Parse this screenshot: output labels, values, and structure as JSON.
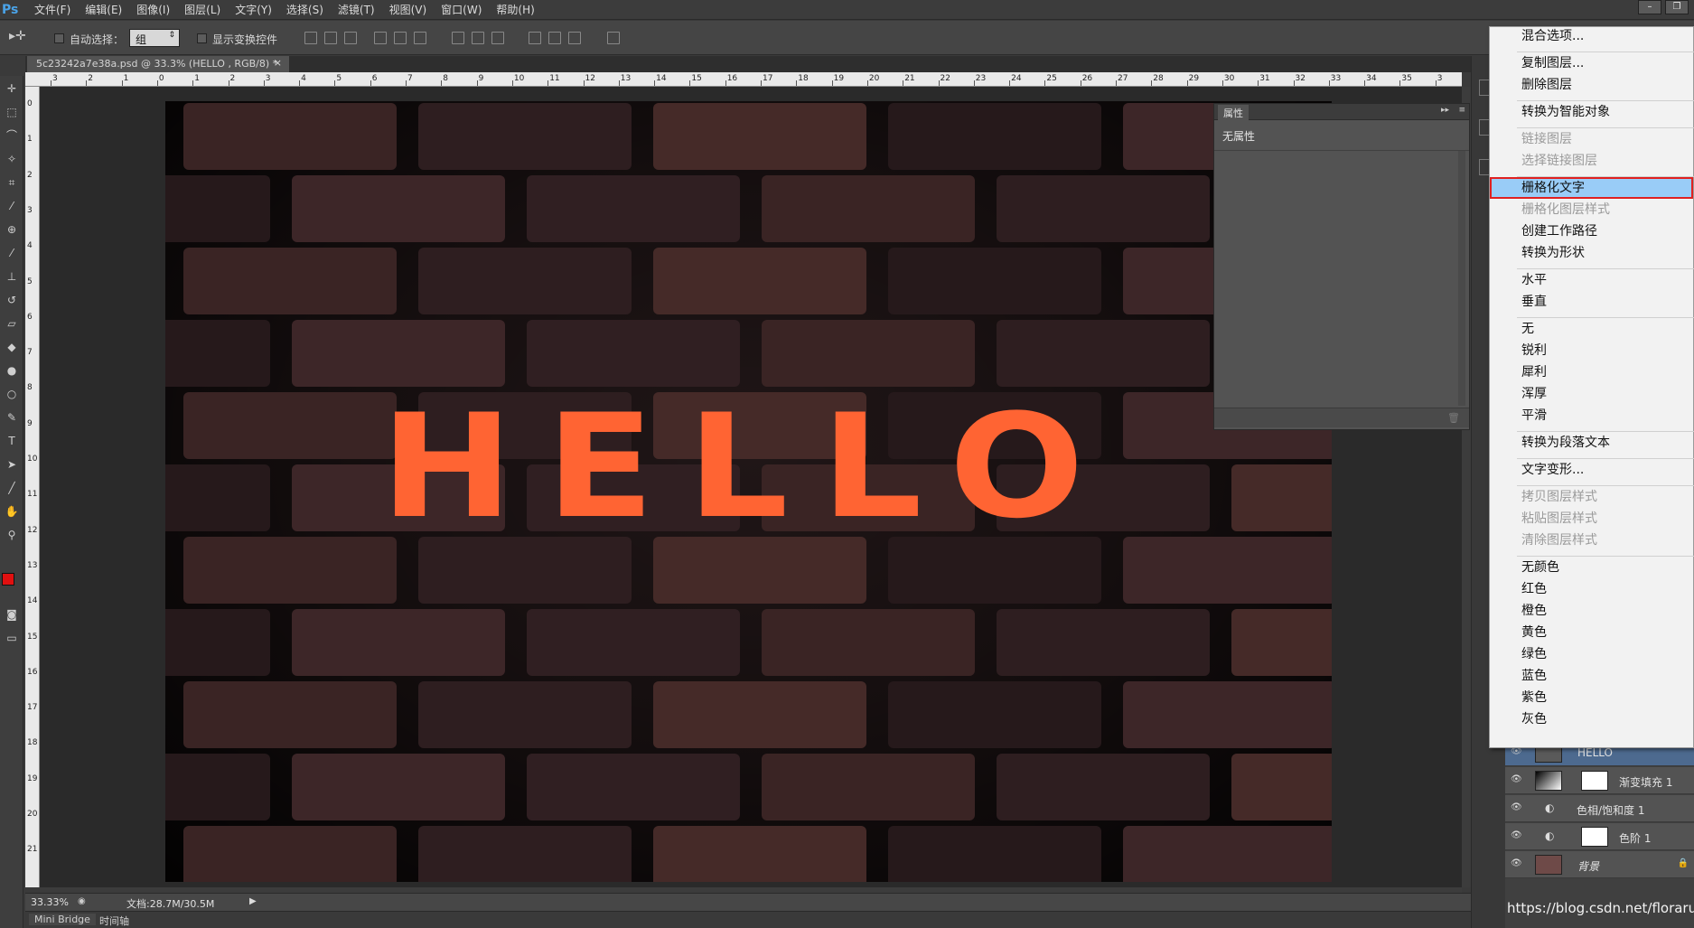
{
  "app": {
    "logo": "Ps"
  },
  "menubar": {
    "items": [
      "文件(F)",
      "编辑(E)",
      "图像(I)",
      "图层(L)",
      "文字(Y)",
      "选择(S)",
      "滤镜(T)",
      "视图(V)",
      "窗口(W)",
      "帮助(H)"
    ],
    "win_min": "–",
    "win_restore": "❐"
  },
  "options": {
    "auto_select_label": "自动选择：",
    "group_value": "组",
    "show_transform_label": "显示变换控件"
  },
  "document": {
    "tab_title": "5c23242a7e38a.psd @ 33.3% (HELLO , RGB/8) *",
    "close": "×",
    "canvas_text": "HELLO",
    "ruler_h": [
      "3",
      "2",
      "1",
      "0",
      "1",
      "2",
      "3",
      "4",
      "5",
      "6",
      "7",
      "8",
      "9",
      "10",
      "11",
      "12",
      "13",
      "14",
      "15",
      "16",
      "17",
      "18",
      "19",
      "20",
      "21",
      "22",
      "23",
      "24",
      "25",
      "26",
      "27",
      "28",
      "29",
      "30",
      "31",
      "32",
      "33",
      "34",
      "35",
      "3"
    ],
    "ruler_v": [
      "0",
      "1",
      "2",
      "3",
      "4",
      "5",
      "6",
      "7",
      "8",
      "9",
      "10",
      "11",
      "12",
      "13",
      "14",
      "15",
      "16",
      "17",
      "18",
      "19",
      "20",
      "21"
    ]
  },
  "properties": {
    "tab": "属性",
    "body": "无属性"
  },
  "context_menu": {
    "items": [
      {
        "label": "混合选项...",
        "disabled": false
      },
      {
        "sep": true
      },
      {
        "label": "复制图层...",
        "disabled": false
      },
      {
        "label": "删除图层",
        "disabled": false
      },
      {
        "sep": true
      },
      {
        "label": "转换为智能对象",
        "disabled": false
      },
      {
        "sep": true
      },
      {
        "label": "链接图层",
        "disabled": true
      },
      {
        "label": "选择链接图层",
        "disabled": true
      },
      {
        "sep": true
      },
      {
        "label": "栅格化文字",
        "disabled": false,
        "highlighted": true
      },
      {
        "label": "栅格化图层样式",
        "disabled": true
      },
      {
        "label": "创建工作路径",
        "disabled": false
      },
      {
        "label": "转换为形状",
        "disabled": false
      },
      {
        "sep": true
      },
      {
        "label": "水平",
        "disabled": false
      },
      {
        "label": "垂直",
        "disabled": false
      },
      {
        "sep": true
      },
      {
        "label": "无",
        "disabled": false
      },
      {
        "label": "锐利",
        "disabled": false
      },
      {
        "label": "犀利",
        "disabled": false
      },
      {
        "label": "浑厚",
        "disabled": false
      },
      {
        "label": "平滑",
        "disabled": false
      },
      {
        "sep": true
      },
      {
        "label": "转换为段落文本",
        "disabled": false
      },
      {
        "sep": true
      },
      {
        "label": "文字变形...",
        "disabled": false
      },
      {
        "sep": true
      },
      {
        "label": "拷贝图层样式",
        "disabled": true
      },
      {
        "label": "粘贴图层样式",
        "disabled": true
      },
      {
        "label": "清除图层样式",
        "disabled": true
      },
      {
        "sep": true
      },
      {
        "label": "无颜色",
        "disabled": false
      },
      {
        "label": "红色",
        "disabled": false
      },
      {
        "label": "橙色",
        "disabled": false
      },
      {
        "label": "黄色",
        "disabled": false
      },
      {
        "label": "绿色",
        "disabled": false
      },
      {
        "label": "蓝色",
        "disabled": false
      },
      {
        "label": "紫色",
        "disabled": false
      },
      {
        "label": "灰色",
        "disabled": false
      }
    ]
  },
  "layers": [
    {
      "name": "HELLO",
      "type": "text"
    },
    {
      "name": "渐变填充 1",
      "type": "gradient"
    },
    {
      "name": "色相/饱和度 1",
      "type": "adjust"
    },
    {
      "name": "色阶 1",
      "type": "adjust-mask"
    },
    {
      "name": "背景",
      "type": "image"
    }
  ],
  "status": {
    "zoom": "33.33%",
    "doc_size": "文档:28.7M/30.5M"
  },
  "bottom_tabs": [
    "Mini Bridge",
    "时间轴"
  ],
  "watermark": "https://blog.csdn.net/floraruo",
  "colors": {
    "foreground": "#e01010",
    "background": "#f0c8b0",
    "text": "#ff6433",
    "highlight": "#99ccf7"
  }
}
